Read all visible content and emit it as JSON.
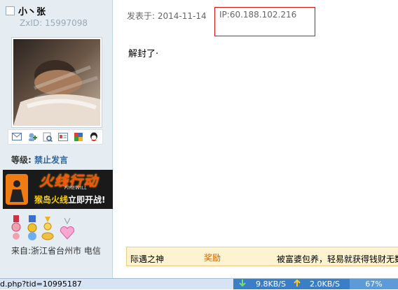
{
  "user": {
    "name": "小丶张",
    "zxid": "ZxID:  15997098",
    "level_label": "等级:",
    "level_value": "禁止发言",
    "from": "来自:浙江省台州市 电信"
  },
  "user_icons": [
    "message-icon",
    "add-friend-icon",
    "view-profile-icon",
    "card-icon",
    "shop-icon",
    "qq-icon"
  ],
  "banner": {
    "title": "火线行动",
    "subtitle": "FIREWILL",
    "tagline_highlight": "猴岛火线",
    "tagline_rest": "立即开战!"
  },
  "post": {
    "posted_at": "发表于: 2014-11-14",
    "ip": "IP:60.188.102.216",
    "content": "解封了·"
  },
  "award_bar": {
    "left": "际遇之神",
    "mid": "奖励",
    "right": "被富婆包养，轻易就获得钱财无数"
  },
  "statusbar": {
    "url": "d.php?tid=10995187",
    "down": "9.8KB/S",
    "up": "2.0KB/S",
    "percent": "67%"
  },
  "colors": {
    "sidebar_bg": "#e5edf2",
    "highlight_box": "#e01010",
    "award_bg": "#fdf3d0"
  }
}
